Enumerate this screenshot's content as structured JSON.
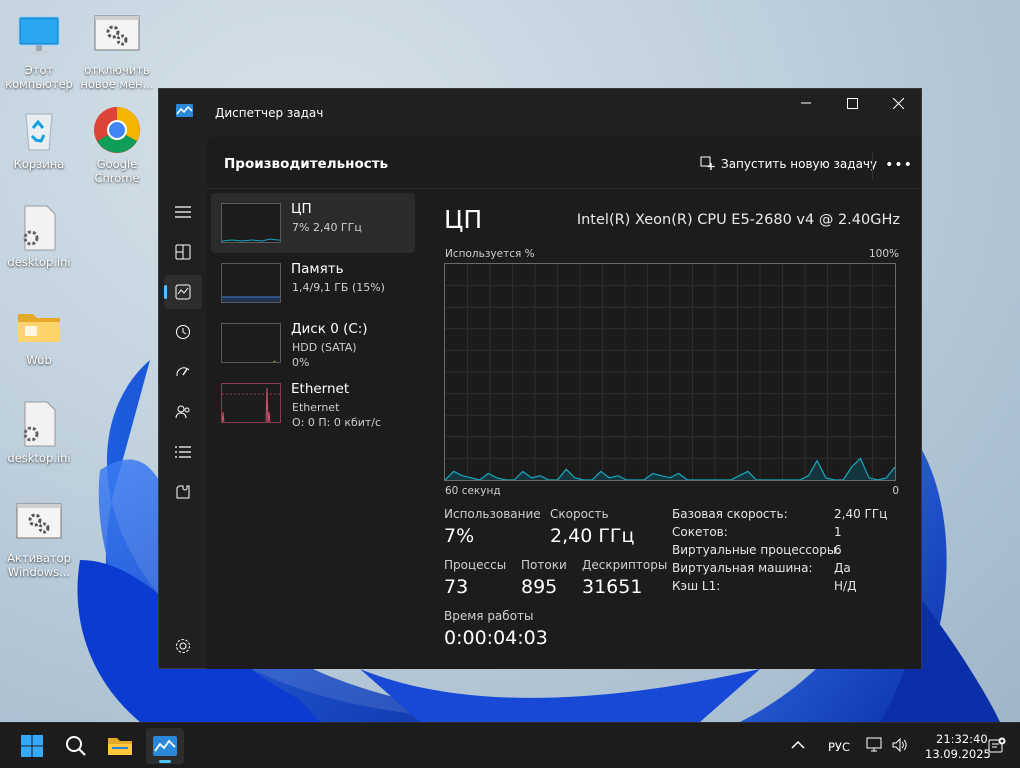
{
  "desktop": {
    "icons": [
      {
        "label": "Этот компьютер",
        "icon": "monitor-icon"
      },
      {
        "label": "отключить новое мен...",
        "icon": "settings-shortcut-icon"
      },
      {
        "label": "Корзина",
        "icon": "recycle-bin-icon"
      },
      {
        "label": "Google Chrome",
        "icon": "chrome-icon"
      },
      {
        "label": "desktop.ini",
        "icon": "ini-file-icon"
      },
      {
        "label": "Wub",
        "icon": "folder-icon"
      },
      {
        "label": "desktop.ini",
        "icon": "ini-file-icon"
      },
      {
        "label": "Активатор Windows...",
        "icon": "settings-shortcut-icon"
      }
    ]
  },
  "window": {
    "title": "Диспетчер задач",
    "controls": {
      "minimize": "—",
      "maximize": "☐",
      "close": "✕"
    },
    "rail": [
      "menu-icon",
      "processes-icon",
      "performance-icon",
      "app-history-icon",
      "startup-icon",
      "users-icon",
      "details-icon",
      "services-icon",
      "settings-icon"
    ],
    "header": {
      "title": "Производительность",
      "run_task": "Запустить новую задачу",
      "more": "•••"
    }
  },
  "perf_list": [
    {
      "name": "ЦП",
      "line2": "7% 2,40 ГГц",
      "line3": ""
    },
    {
      "name": "Память",
      "line2": "1,4/9,1 ГБ (15%)",
      "line3": ""
    },
    {
      "name": "Диск 0 (C:)",
      "line2": "HDD (SATA)",
      "line3": "0%"
    },
    {
      "name": "Ethernet",
      "line2": "Ethernet",
      "line3": "О: 0 П: 0 кбит/с"
    }
  ],
  "cpu": {
    "title": "ЦП",
    "model": "Intel(R) Xeon(R) CPU E5-2680 v4 @ 2.40GHz",
    "graph_label": "Используется %",
    "graph_max": "100%",
    "time_label": "60 секунд",
    "time_min": "0",
    "stats": {
      "usage_label": "Использование",
      "usage": "7%",
      "speed_label": "Скорость",
      "speed": "2,40 ГГц",
      "processes_label": "Процессы",
      "processes": "73",
      "threads_label": "Потоки",
      "threads": "895",
      "handles_label": "Дескрипторы",
      "handles": "31651",
      "uptime_label": "Время работы",
      "uptime": "0:00:04:03"
    },
    "details": [
      {
        "k": "Базовая скорость:",
        "v": "2,40 ГГц"
      },
      {
        "k": "Сокетов:",
        "v": "1"
      },
      {
        "k": "Виртуальные процессоры:",
        "v": "6"
      },
      {
        "k": "Виртуальная машина:",
        "v": "Да"
      },
      {
        "k": "Кэш L1:",
        "v": "Н/Д"
      }
    ],
    "usage_history": [
      0,
      4,
      2,
      1,
      0,
      3,
      1,
      0,
      0,
      4,
      1,
      2,
      0,
      0,
      5,
      1,
      0,
      0,
      4,
      1,
      2,
      0,
      0,
      0,
      3,
      2,
      1,
      3,
      0,
      0,
      0,
      0,
      0,
      0,
      2,
      4,
      0,
      0,
      0,
      0,
      0,
      0,
      2,
      9,
      1,
      0,
      0,
      6,
      10,
      1,
      0,
      1,
      6
    ]
  },
  "taskbar": {
    "apps": [
      "start-icon",
      "search-icon",
      "file-explorer-icon",
      "task-manager-icon"
    ],
    "lang": "РУС",
    "time": "21:32:40",
    "date": "13.09.2025"
  },
  "colors": {
    "accent": "#4cc2ff",
    "cpu_line": "#17a7bc",
    "mem_line": "#3f7fd6",
    "disk_line": "#7cbd3a",
    "net_line": "#d3506e"
  }
}
